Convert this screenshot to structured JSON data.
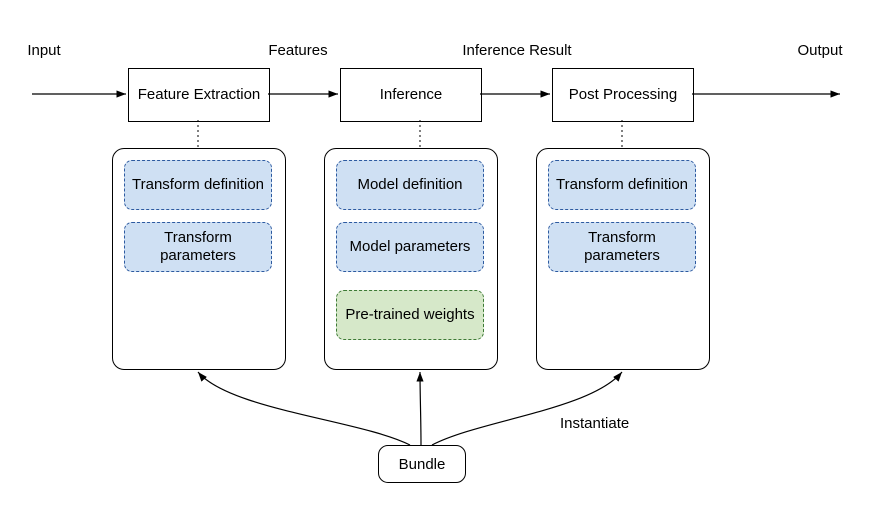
{
  "domain": "Diagram",
  "flow_labels": {
    "input": "Input",
    "features": "Features",
    "inference_result": "Inference Result",
    "output": "Output"
  },
  "stages": {
    "feature_extraction": "Feature\nExtraction",
    "inference": "Inference",
    "post_processing": "Post Processing"
  },
  "panels": {
    "fe": {
      "item1": "Transform\ndefinition",
      "item2": "Transform\nparameters"
    },
    "inf": {
      "item1": "Model\ndefinition",
      "item2": "Model\nparameters",
      "item3": "Pre-trained\nweights"
    },
    "pp": {
      "item1": "Transform\ndefinition",
      "item2": "Transform\nparameters"
    }
  },
  "bundle_label": "Bundle",
  "instantiate_label": "Instantiate",
  "chart_data": {
    "type": "diagram",
    "title": "",
    "pipeline": [
      {
        "stage": "Feature Extraction",
        "input_edge": "Input",
        "output_edge": "Features",
        "components": [
          "Transform definition",
          "Transform parameters"
        ]
      },
      {
        "stage": "Inference",
        "input_edge": "Features",
        "output_edge": "Inference Result",
        "components": [
          "Model definition",
          "Model parameters",
          "Pre-trained weights"
        ]
      },
      {
        "stage": "Post Processing",
        "input_edge": "Inference Result",
        "output_edge": "Output",
        "components": [
          "Transform definition",
          "Transform parameters"
        ]
      }
    ],
    "source_node": "Bundle",
    "source_edge_label": "Instantiate",
    "source_targets": [
      "Feature Extraction panel",
      "Inference panel",
      "Post Processing panel"
    ]
  }
}
